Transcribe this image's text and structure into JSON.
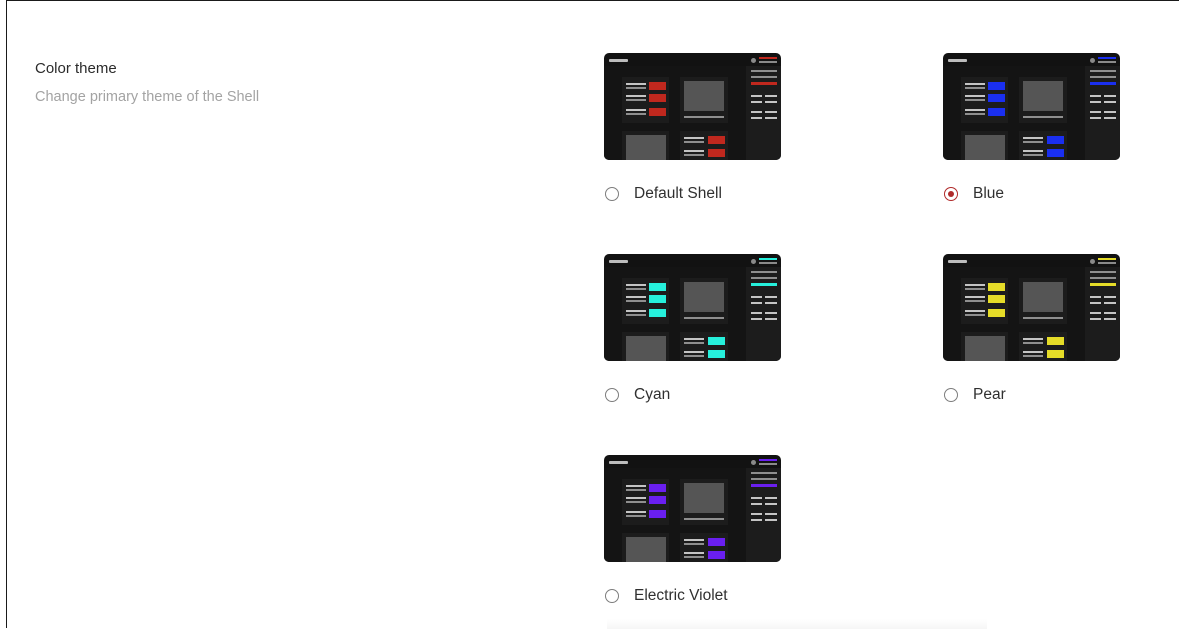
{
  "setting": {
    "title": "Color theme",
    "description": "Change primary theme of the Shell"
  },
  "themes": [
    {
      "label": "Default Shell",
      "accent": "#c0281e",
      "selected": false
    },
    {
      "label": "Blue",
      "accent": "#1a2ff0",
      "selected": true
    },
    {
      "label": "Cyan",
      "accent": "#26f0dc",
      "selected": false
    },
    {
      "label": "Pear",
      "accent": "#e5dc28",
      "selected": false
    },
    {
      "label": "Electric Violet",
      "accent": "#6a1ff0",
      "selected": false
    }
  ],
  "colors": {
    "radio_selected": "#b02a2a",
    "thumbnail_background": "#121212"
  }
}
